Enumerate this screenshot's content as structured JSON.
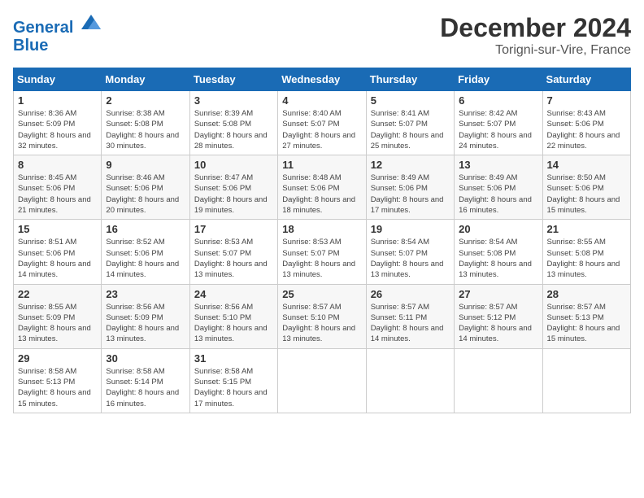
{
  "header": {
    "logo_line1": "General",
    "logo_line2": "Blue",
    "month_title": "December 2024",
    "location": "Torigni-sur-Vire, France"
  },
  "weekdays": [
    "Sunday",
    "Monday",
    "Tuesday",
    "Wednesday",
    "Thursday",
    "Friday",
    "Saturday"
  ],
  "weeks": [
    [
      {
        "day": "1",
        "sunrise": "8:36 AM",
        "sunset": "5:09 PM",
        "daylight": "8 hours and 32 minutes."
      },
      {
        "day": "2",
        "sunrise": "8:38 AM",
        "sunset": "5:08 PM",
        "daylight": "8 hours and 30 minutes."
      },
      {
        "day": "3",
        "sunrise": "8:39 AM",
        "sunset": "5:08 PM",
        "daylight": "8 hours and 28 minutes."
      },
      {
        "day": "4",
        "sunrise": "8:40 AM",
        "sunset": "5:07 PM",
        "daylight": "8 hours and 27 minutes."
      },
      {
        "day": "5",
        "sunrise": "8:41 AM",
        "sunset": "5:07 PM",
        "daylight": "8 hours and 25 minutes."
      },
      {
        "day": "6",
        "sunrise": "8:42 AM",
        "sunset": "5:07 PM",
        "daylight": "8 hours and 24 minutes."
      },
      {
        "day": "7",
        "sunrise": "8:43 AM",
        "sunset": "5:06 PM",
        "daylight": "8 hours and 22 minutes."
      }
    ],
    [
      {
        "day": "8",
        "sunrise": "8:45 AM",
        "sunset": "5:06 PM",
        "daylight": "8 hours and 21 minutes."
      },
      {
        "day": "9",
        "sunrise": "8:46 AM",
        "sunset": "5:06 PM",
        "daylight": "8 hours and 20 minutes."
      },
      {
        "day": "10",
        "sunrise": "8:47 AM",
        "sunset": "5:06 PM",
        "daylight": "8 hours and 19 minutes."
      },
      {
        "day": "11",
        "sunrise": "8:48 AM",
        "sunset": "5:06 PM",
        "daylight": "8 hours and 18 minutes."
      },
      {
        "day": "12",
        "sunrise": "8:49 AM",
        "sunset": "5:06 PM",
        "daylight": "8 hours and 17 minutes."
      },
      {
        "day": "13",
        "sunrise": "8:49 AM",
        "sunset": "5:06 PM",
        "daylight": "8 hours and 16 minutes."
      },
      {
        "day": "14",
        "sunrise": "8:50 AM",
        "sunset": "5:06 PM",
        "daylight": "8 hours and 15 minutes."
      }
    ],
    [
      {
        "day": "15",
        "sunrise": "8:51 AM",
        "sunset": "5:06 PM",
        "daylight": "8 hours and 14 minutes."
      },
      {
        "day": "16",
        "sunrise": "8:52 AM",
        "sunset": "5:06 PM",
        "daylight": "8 hours and 14 minutes."
      },
      {
        "day": "17",
        "sunrise": "8:53 AM",
        "sunset": "5:07 PM",
        "daylight": "8 hours and 13 minutes."
      },
      {
        "day": "18",
        "sunrise": "8:53 AM",
        "sunset": "5:07 PM",
        "daylight": "8 hours and 13 minutes."
      },
      {
        "day": "19",
        "sunrise": "8:54 AM",
        "sunset": "5:07 PM",
        "daylight": "8 hours and 13 minutes."
      },
      {
        "day": "20",
        "sunrise": "8:54 AM",
        "sunset": "5:08 PM",
        "daylight": "8 hours and 13 minutes."
      },
      {
        "day": "21",
        "sunrise": "8:55 AM",
        "sunset": "5:08 PM",
        "daylight": "8 hours and 13 minutes."
      }
    ],
    [
      {
        "day": "22",
        "sunrise": "8:55 AM",
        "sunset": "5:09 PM",
        "daylight": "8 hours and 13 minutes."
      },
      {
        "day": "23",
        "sunrise": "8:56 AM",
        "sunset": "5:09 PM",
        "daylight": "8 hours and 13 minutes."
      },
      {
        "day": "24",
        "sunrise": "8:56 AM",
        "sunset": "5:10 PM",
        "daylight": "8 hours and 13 minutes."
      },
      {
        "day": "25",
        "sunrise": "8:57 AM",
        "sunset": "5:10 PM",
        "daylight": "8 hours and 13 minutes."
      },
      {
        "day": "26",
        "sunrise": "8:57 AM",
        "sunset": "5:11 PM",
        "daylight": "8 hours and 14 minutes."
      },
      {
        "day": "27",
        "sunrise": "8:57 AM",
        "sunset": "5:12 PM",
        "daylight": "8 hours and 14 minutes."
      },
      {
        "day": "28",
        "sunrise": "8:57 AM",
        "sunset": "5:13 PM",
        "daylight": "8 hours and 15 minutes."
      }
    ],
    [
      {
        "day": "29",
        "sunrise": "8:58 AM",
        "sunset": "5:13 PM",
        "daylight": "8 hours and 15 minutes."
      },
      {
        "day": "30",
        "sunrise": "8:58 AM",
        "sunset": "5:14 PM",
        "daylight": "8 hours and 16 minutes."
      },
      {
        "day": "31",
        "sunrise": "8:58 AM",
        "sunset": "5:15 PM",
        "daylight": "8 hours and 17 minutes."
      },
      null,
      null,
      null,
      null
    ]
  ]
}
